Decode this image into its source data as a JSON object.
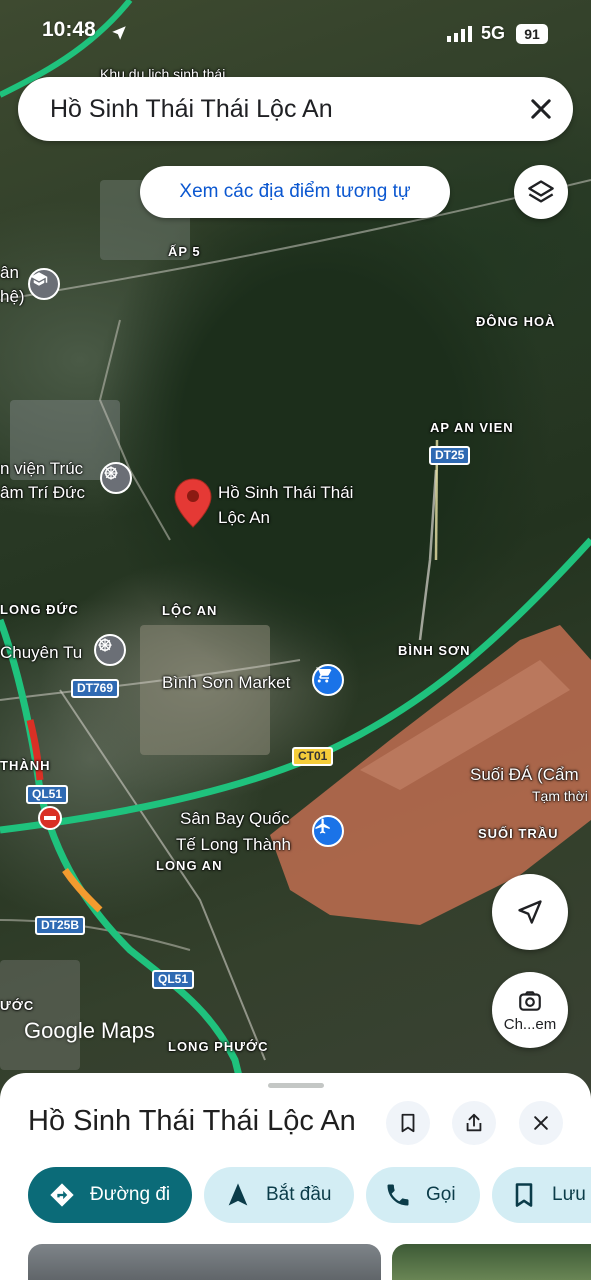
{
  "status_bar": {
    "time": "10:48",
    "network": "5G",
    "battery": "91"
  },
  "search": {
    "query": "Hồ Sinh Thái Thái Lộc An"
  },
  "similar_places_chip": "Xem các địa điểm tương tự",
  "map": {
    "pin_label_line1": "Hồ Sinh Thái Thái",
    "pin_label_line2": "Lộc An",
    "area_labels": {
      "ap5": "ẤP 5",
      "dong_hoa": "ĐÔNG HOÀ",
      "ap_an_vien": "AP AN VIEN",
      "long_duc": "LONG ĐỨC",
      "loc_an": "LỘC AN",
      "binh_son": "BÌNH SƠN",
      "thanh": "THÀNH",
      "suoi_trau": "SUỐI TRẦU",
      "long_an": "LONG AN",
      "long_phuoc": "LONG PHƯỚC",
      "uoc": "ƯỚC"
    },
    "place_labels": {
      "top_partial": "Khu du lịch sinh thái",
      "an_partial": "ân",
      "he_partial": "hệ)",
      "vien_truc_line1": "n viện Trúc",
      "vien_truc_line2": "âm Trí Đức",
      "chuyen_tu": "Chuyên Tu",
      "binh_son_market": "Bình Sơn Market",
      "suoi_da": "Suối ĐÁ (Cẩm",
      "tam_thoi": "Tạm thời",
      "airport_line1": "Sân Bay Quốc",
      "airport_line2": "Tế Long Thành"
    },
    "road_shields": {
      "dt25": "DT25",
      "dt769": "DT769",
      "ct01": "CT01",
      "ql51_top": "QL51",
      "dt25b": "DT25B",
      "ql51_bottom": "QL51"
    },
    "logo": "Google Maps",
    "street_view_label": "Ch...em",
    "road_colors": {
      "traffic_green": "#1fc27d",
      "traffic_red": "#d93025",
      "traffic_orange": "#f29b2f"
    }
  },
  "sheet": {
    "title": "Hồ Sinh Thái Thái Lộc An",
    "actions": {
      "directions": "Đường đi",
      "start": "Bắt đầu",
      "call": "Gọi",
      "save": "Lưu"
    }
  },
  "icons": {
    "status": [
      "location-arrow-icon",
      "signal-icon",
      "battery-icon"
    ],
    "search_close": "close-icon",
    "layers": "layers-icon",
    "my_location": "navigation-icon",
    "street_view": "camera-icon",
    "sheet_buttons": [
      "bookmark-icon",
      "share-icon",
      "close-icon"
    ],
    "action_icons": [
      "directions-icon",
      "navigation-arrow-icon",
      "phone-icon",
      "bookmark-icon"
    ]
  }
}
